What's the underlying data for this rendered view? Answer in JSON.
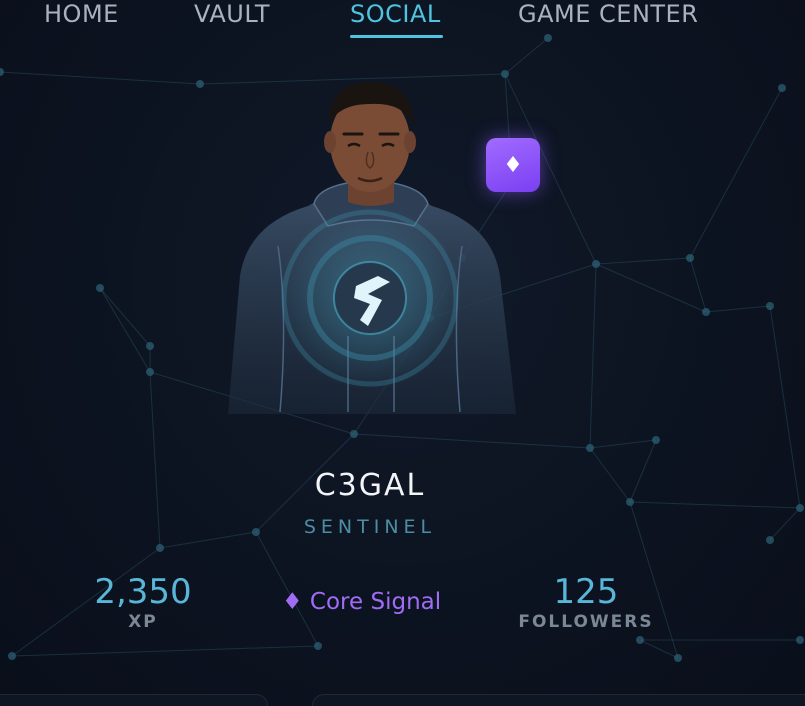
{
  "nav": {
    "items": [
      {
        "label": "HOME",
        "active": false
      },
      {
        "label": "VAULT",
        "active": false
      },
      {
        "label": "SOCIAL",
        "active": true
      },
      {
        "label": "GAME CENTER",
        "active": false
      }
    ]
  },
  "profile": {
    "username": "C3GAL",
    "rank": "SENTINEL",
    "badge_icon": "diamond-icon",
    "badge_glyph": "♦"
  },
  "stats": {
    "xp_value": "2,350",
    "xp_label": "XP",
    "signal_label": "♦ Core Signal",
    "followers_value": "125",
    "followers_label": "FOLLOWERS"
  },
  "colors": {
    "accent": "#4fc3e0",
    "badge": "#8a4fff",
    "signal": "#a06cf5",
    "background": "#0c1320"
  }
}
